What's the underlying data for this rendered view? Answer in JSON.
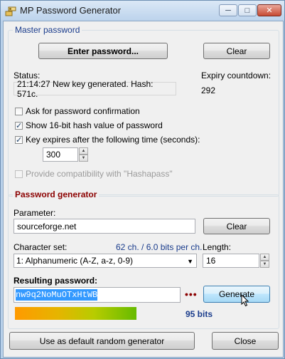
{
  "window": {
    "title": "MP Password Generator",
    "min_icon": "minimize-icon",
    "max_icon": "maximize-icon",
    "close_icon": "close-icon"
  },
  "master": {
    "legend": "Master password",
    "enter_label": "Enter password...",
    "clear_label": "Clear",
    "status_label": "Status:",
    "status_value": "21:14:27 New key generated. Hash: 571c.",
    "expiry_label": "Expiry countdown:",
    "expiry_value": "292",
    "options": [
      {
        "label": "Ask for password confirmation",
        "checked": false,
        "enabled": true
      },
      {
        "label": "Show 16-bit hash value of password",
        "checked": true,
        "enabled": true
      },
      {
        "label": "Key expires after the following time (seconds):",
        "checked": true,
        "enabled": true
      },
      {
        "label": "Provide compatibility with \"Hashapass\"",
        "checked": false,
        "enabled": false
      }
    ],
    "expiry_seconds": "300"
  },
  "generator": {
    "legend": "Password generator",
    "parameter_label": "Parameter:",
    "parameter_value": "sourceforge.net",
    "clear_label": "Clear",
    "charset_label": "Character set:",
    "charset_info": "62 ch. / 6.0 bits per ch.",
    "charset_value": "1: Alphanumeric (A-Z, a-z, 0-9)",
    "length_label": "Length:",
    "length_value": "16",
    "result_label": "Resulting password:",
    "result_value": "nw9q2NoMuOTxHtWB",
    "dots": "•••",
    "generate_label": "Generate",
    "bits_label": "95 bits",
    "strength_fraction": 0.63
  },
  "footer": {
    "default_label": "Use as default random generator",
    "close_label": "Close"
  },
  "colors": {
    "legend_red": "#8b0000",
    "info_blue": "#1a3c8c",
    "selection": "#3399ff",
    "dots": "#8b0000"
  }
}
